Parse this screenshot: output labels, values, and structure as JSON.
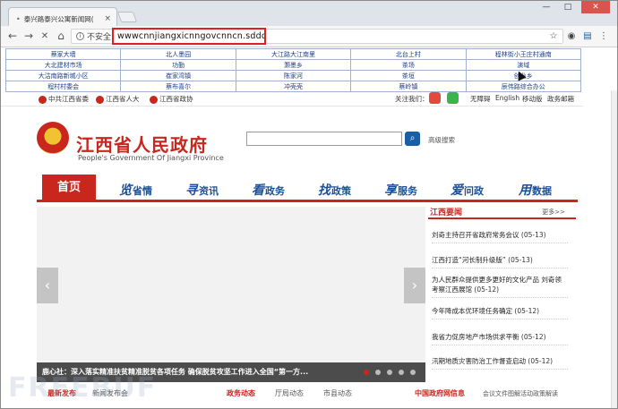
{
  "browser": {
    "tab_title": "泰兴路泰兴公寓新闻网(",
    "tab_favicon": "•",
    "close_tab": "×",
    "new_tab": "",
    "minimize": "—",
    "maximize": "□",
    "close_window": "✕",
    "security_label": "不安全",
    "url": "wwwcnnjiangxicnngovcnncn.sdddzg.cn",
    "icons": {
      "back": "←",
      "forward": "→",
      "reload": "✕",
      "home": "⌂",
      "star": "☆",
      "ext1": "◉",
      "ext2": "▤",
      "menu": "⋮"
    }
  },
  "link_grid": [
    [
      "蔡家大墙",
      "北人墨园",
      "大江路大江南里",
      "北台上村",
      "程林街小王庄村通南"
    ],
    [
      "大北建材市场",
      "功勤",
      "灏墨乡",
      "茶场",
      "演域"
    ],
    [
      "大沽南路新城小区",
      "崔家湾镇",
      "陈家河",
      "茶垣",
      "创业乡"
    ],
    [
      "程村村委会",
      "蔡布喜尔",
      "冲壳壳",
      "蔡岭镇",
      "辰伟路综合办公"
    ]
  ],
  "topbar": {
    "links": [
      "中共江西省委",
      "江西省人大",
      "江西省政协"
    ],
    "follow": "关注我们：",
    "right_links": [
      "无障碍",
      "English",
      "移动版",
      "政务邮箱"
    ]
  },
  "header": {
    "site_name": "江西省人民政府",
    "site_name_en": "People's Government Of Jiangxi Province",
    "search_placeholder": "",
    "search_icon": "⌕",
    "advanced_search": "高级搜索"
  },
  "nav": {
    "home": "首页",
    "items": [
      {
        "big": "览",
        "rest": "省情"
      },
      {
        "big": "寻",
        "rest": "资讯"
      },
      {
        "big": "看",
        "rest": "政务"
      },
      {
        "big": "找",
        "rest": "政策"
      },
      {
        "big": "享",
        "rest": "服务"
      },
      {
        "big": "爱",
        "rest": "问政"
      },
      {
        "big": "用",
        "rest": "数据"
      }
    ]
  },
  "carousel": {
    "caption": "鹿心社：深入落实精准扶贫精准脱贫各项任务 确保脱贫攻坚工作进入全国“第一方...",
    "prev": "‹",
    "next": "›",
    "active_index": 0,
    "dot_count": 5
  },
  "news": {
    "title": "江西要闻",
    "more": "更多>>",
    "items": [
      {
        "text": "刘奇主持召开省政府常务会议",
        "date": "(05-13)"
      },
      {
        "text": "江西打造“河长制升级版”",
        "date": "(05-13)"
      },
      {
        "text": "为人民群众提供更多更好的文化产品 刘奇领考察江西展馆",
        "date": "(05-12)"
      },
      {
        "text": "今年降成本优环境任务确定",
        "date": "(05-12)"
      },
      {
        "text": "我省力促房地产市场供求平衡",
        "date": "(05-12)"
      },
      {
        "text": "汛期地质灾害防治工作督查启动",
        "date": "(05-12)"
      }
    ]
  },
  "bottom": {
    "tabs": [
      "最新发布",
      "新闻发布会",
      "政务动态",
      "厅局动态",
      "市县动态",
      "中国政府网信息",
      "会议文件图解活动政策解读"
    ]
  },
  "watermark": "FREEBUF",
  "colors": {
    "brand_red": "#c9261e",
    "nav_blue": "#1a4f99",
    "url_highlight": "#e02020"
  }
}
